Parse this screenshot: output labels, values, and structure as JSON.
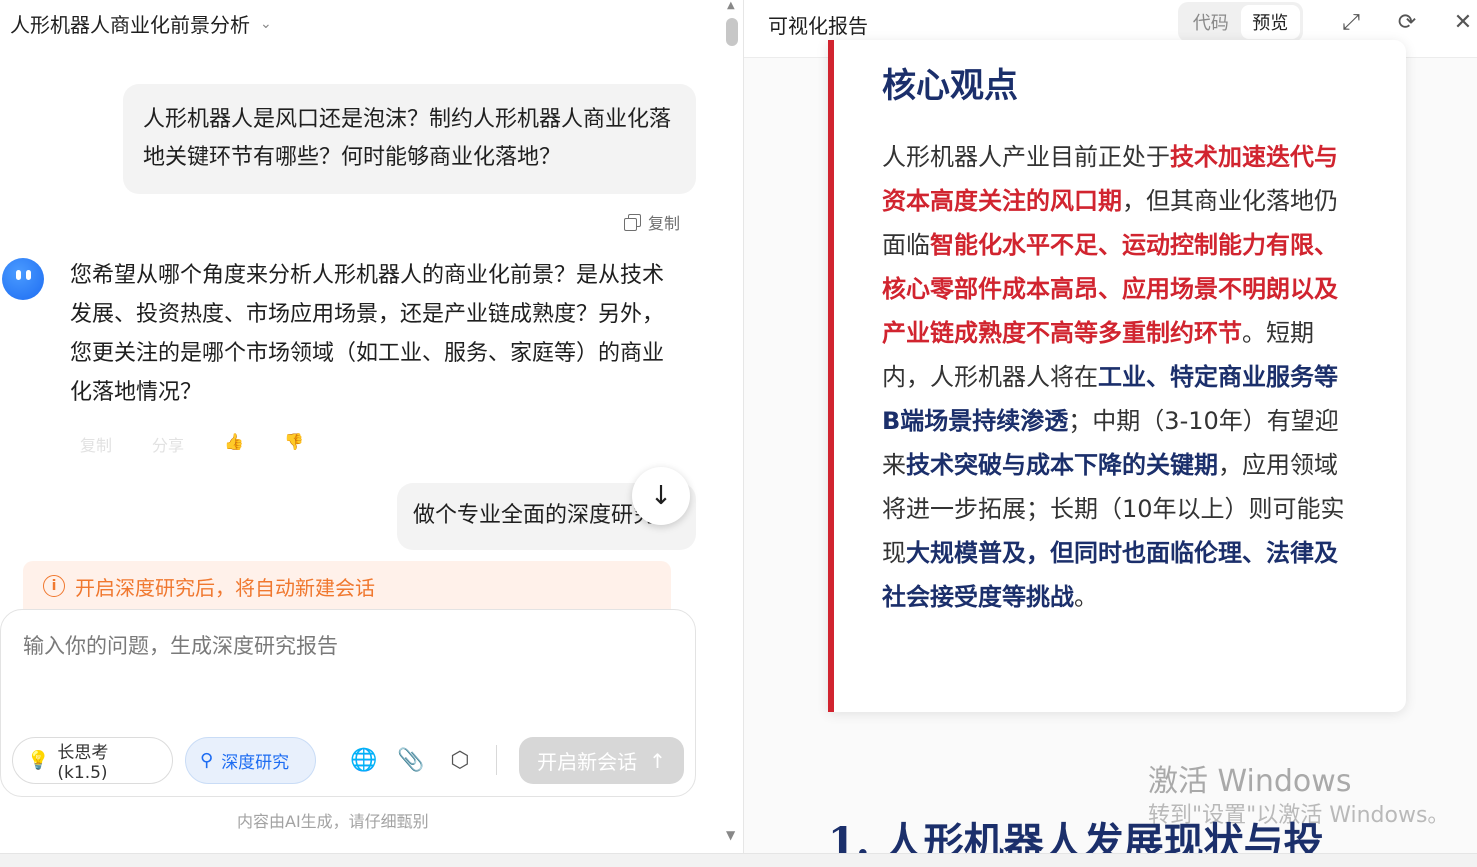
{
  "conversation": {
    "title": "人形机器人商业化前景分析"
  },
  "messages": {
    "user1": "人形机器人是风口还是泡沫？制约人形机器人商业化落地关键环节有哪些？何时能够商业化落地？",
    "copy_label": "复制",
    "bot1": "您希望从哪个角度来分析人形机器人的商业化前景？是从技术发展、投资热度、市场应用场景，还是产业链成熟度？另外，您更关注的是哪个市场领域（如工业、服务、家庭等）的商业化落地情况？",
    "bot_actions": {
      "copy": "复制",
      "share": "分享",
      "like": "👍",
      "dislike": "👎"
    },
    "user2": "做个专业全面的深度研究"
  },
  "notice": {
    "text": "开启深度研究后，将自动新建会话"
  },
  "composer": {
    "placeholder": "输入你的问题，生成深度研究报告",
    "long_think": "长思考 (k1.5)",
    "deep_research": "深度研究",
    "send_label": "开启新会话",
    "disclaimer": "内容由AI生成，请仔细甄别"
  },
  "report": {
    "title": "可视化报告",
    "tab_code": "代码",
    "tab_preview": "预览",
    "card_title": "核心观点",
    "body": [
      {
        "t": "人形机器人产业目前正处于",
        "s": "n"
      },
      {
        "t": "技术加速迭代与资本高度关注的风口期",
        "s": "red"
      },
      {
        "t": "，但其商业化落地仍面临",
        "s": "n"
      },
      {
        "t": "智能化水平不足、运动控制能力有限、核心零部件成本高昂、应用场景不明朗以及产业链成熟度不高等多重制约环节",
        "s": "red"
      },
      {
        "t": "。短期内，人形机器人将在",
        "s": "n"
      },
      {
        "t": "工业、特定商业服务等B端场景持续渗透",
        "s": "blue"
      },
      {
        "t": "；中期（3-10年）有望迎来",
        "s": "n"
      },
      {
        "t": "技术突破与成本下降的关键期",
        "s": "blue"
      },
      {
        "t": "，应用领域将进一步拓展；长期（10年以上）则可能实现",
        "s": "n"
      },
      {
        "t": "大规模普及，但同时也面临伦理、法律及社会接受度等挑战",
        "s": "blue"
      },
      {
        "t": "。",
        "s": "n"
      }
    ],
    "next_section": "1. 人形机器人发展现状与投"
  },
  "watermark": {
    "line1": "激活 Windows",
    "line2": "转到\"设置\"以激活 Windows。"
  },
  "colors": {
    "accent_red": "#d1242f",
    "accent_navy": "#1b2f6b",
    "brand_blue": "#1d6cf2",
    "notice_orange": "#f0782f"
  }
}
